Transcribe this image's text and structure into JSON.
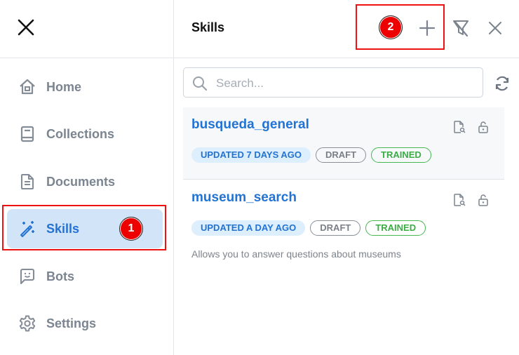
{
  "sidebar": {
    "close_icon": "close-icon",
    "items": [
      {
        "label": "Home",
        "icon": "home-icon",
        "active": false
      },
      {
        "label": "Collections",
        "icon": "book-icon",
        "active": false
      },
      {
        "label": "Documents",
        "icon": "document-icon",
        "active": false
      },
      {
        "label": "Skills",
        "icon": "magic-wand-icon",
        "active": true
      },
      {
        "label": "Bots",
        "icon": "chat-bot-icon",
        "active": false
      },
      {
        "label": "Settings",
        "icon": "gear-icon",
        "active": false
      }
    ]
  },
  "header": {
    "title": "Skills",
    "add_icon": "plus-icon",
    "filter_off_icon": "filter-off-icon",
    "close_icon": "close-icon"
  },
  "search": {
    "placeholder": "Search...",
    "value": ""
  },
  "skills": [
    {
      "name": "busqueda_general",
      "updated": "UPDATED 7 DAYS AGO",
      "status": "DRAFT",
      "training": "TRAINED",
      "description": ""
    },
    {
      "name": "museum_search",
      "updated": "UPDATED A DAY AGO",
      "status": "DRAFT",
      "training": "TRAINED",
      "description": "Allows you to answer questions about museums"
    }
  ],
  "annotations": [
    {
      "label": "1",
      "color": "#ee0000"
    },
    {
      "label": "2",
      "color": "#ee0000"
    }
  ]
}
